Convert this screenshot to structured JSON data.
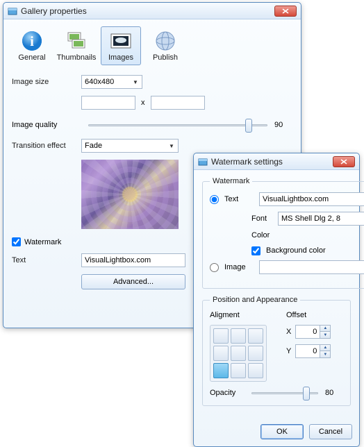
{
  "main": {
    "title": "Gallery properties",
    "tabs": {
      "general": "General",
      "thumbnails": "Thumbnails",
      "images": "Images",
      "publish": "Publish"
    },
    "image_size_label": "Image size",
    "image_size_value": "640x480",
    "dim_x": "x",
    "quality_label": "Image quality",
    "quality_value": "90",
    "transition_label": "Transition effect",
    "transition_value": "Fade",
    "watermark_chk": "Watermark",
    "text_label": "Text",
    "text_value": "VisualLightbox.com",
    "advanced_btn": "Advanced..."
  },
  "wm": {
    "title": "Watermark settings",
    "group_label": "Watermark",
    "radio_text": "Text",
    "text_value": "VisualLightbox.com",
    "font_label": "Font",
    "font_value": "MS Shell Dlg 2, 8",
    "color_label": "Color",
    "color_value": "#000000",
    "bgcolor_label": "Background color",
    "bgcolor_value": "#ffffff",
    "radio_image": "Image",
    "image_value": "",
    "pos_group": "Position and Appearance",
    "alignment_hd": "Aligment",
    "offset_hd": "Offset",
    "x_label": "X",
    "x_value": "0",
    "y_label": "Y",
    "y_value": "0",
    "opacity_label": "Opacity",
    "opacity_value": "80",
    "ok": "OK",
    "cancel": "Cancel"
  }
}
